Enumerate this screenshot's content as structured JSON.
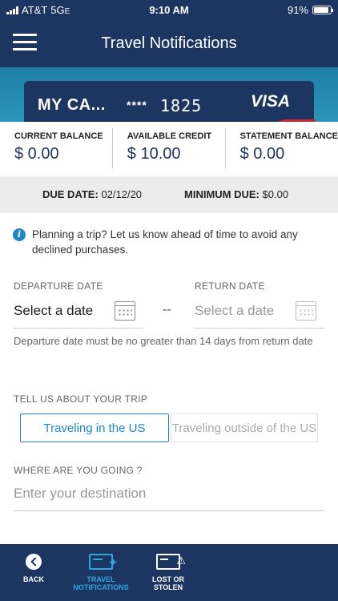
{
  "status_bar": {
    "carrier": "AT&T",
    "network": "5G",
    "network_suffix": "E",
    "time": "9:10 AM",
    "battery": "91%",
    "battery_level": 0.91
  },
  "header": {
    "title": "Travel Notifications",
    "menu_icon": "hamburger-menu-icon"
  },
  "card": {
    "name": "MY CA...",
    "masked": "****",
    "last4": "1825",
    "brand": "VISA"
  },
  "balances": [
    {
      "label": "CURRENT BALANCE",
      "value": "$ 0.00"
    },
    {
      "label": "AVAILABLE CREDIT",
      "value": "$ 10.00"
    },
    {
      "label": "STATEMENT BALANCE",
      "value": "$ 0.00"
    }
  ],
  "due": {
    "due_label": "DUE DATE:",
    "due_value": "02/12/20",
    "min_label": "MINIMUM DUE:",
    "min_value": "$0.00"
  },
  "info": {
    "icon": "info-icon",
    "text": "Planning a trip? Let us know ahead of time to avoid any declined purchases."
  },
  "dates": {
    "departure_label": "DEPARTURE DATE",
    "departure_value": "Select a date",
    "separator": "--",
    "return_label": "RETURN DATE",
    "return_value": "Select a date",
    "hint": "Departure date must be no greater than 14 days from return date"
  },
  "trip": {
    "label": "TELL US ABOUT YOUR TRIP",
    "options": [
      "Traveling in the US",
      "Traveling outside of the US"
    ],
    "selected": "Traveling in the US"
  },
  "destination": {
    "label": "WHERE ARE YOU GOING ?",
    "placeholder": "Enter your destination"
  },
  "colors": {
    "navy": "#1c3561",
    "accent": "#1e88c7",
    "nav_active": "#2ea7e0"
  },
  "bottom_nav": [
    {
      "label_1": "BACK",
      "label_2": "",
      "icon": "back-icon"
    },
    {
      "label_1": "TRAVEL",
      "label_2": "NOTIFICATIONS",
      "icon": "travel-card-icon"
    },
    {
      "label_1": "LOST OR",
      "label_2": "STOLEN",
      "icon": "lost-card-icon"
    }
  ]
}
